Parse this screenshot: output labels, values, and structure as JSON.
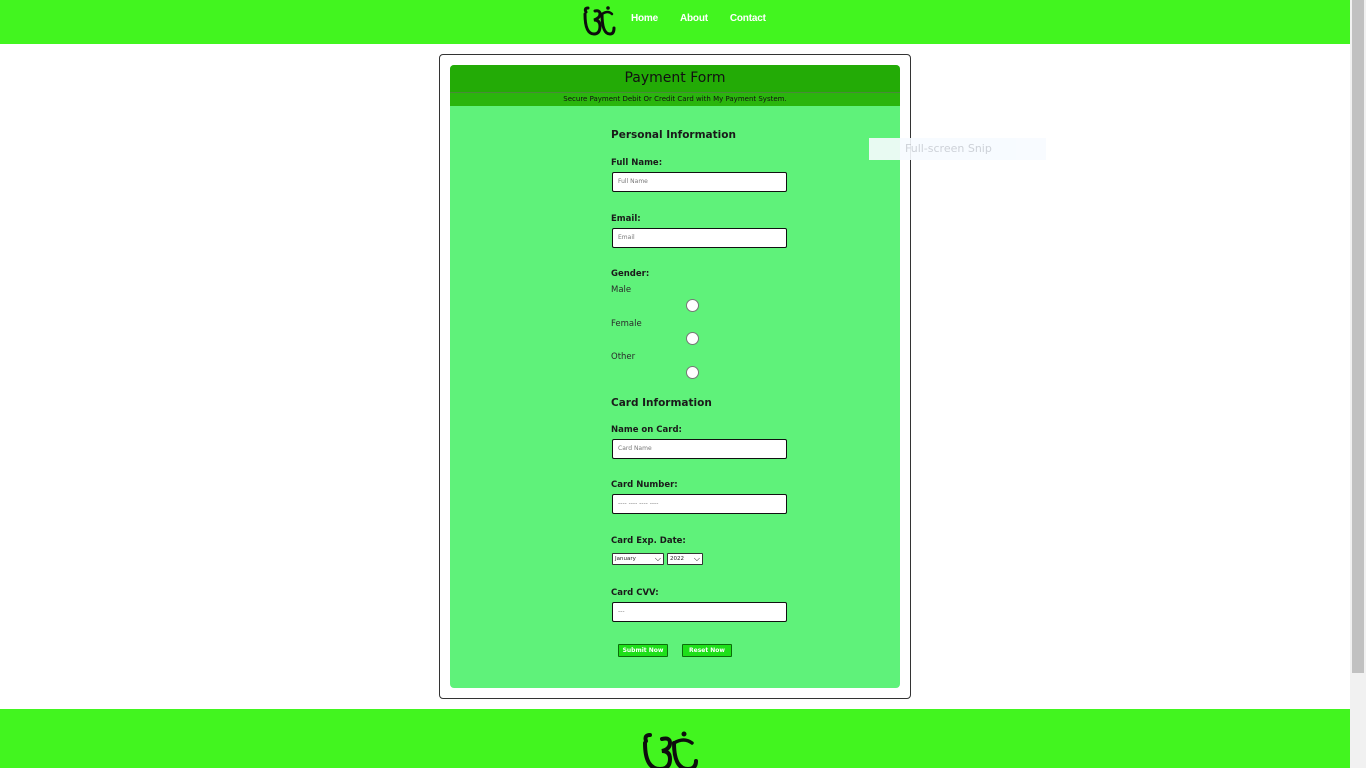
{
  "nav": {
    "links": [
      "Home",
      "About",
      "Contact"
    ]
  },
  "form": {
    "title": "Payment Form",
    "subtitle": "Secure Payment Debit Or Credit Card with My Payment System.",
    "personal_section": "Personal Information",
    "full_name_label": "Full Name:",
    "full_name_placeholder": "Full Name",
    "email_label": "Email:",
    "email_placeholder": "Email",
    "gender_label": "Gender:",
    "gender_options": [
      "Male",
      "Female",
      "Other"
    ],
    "card_section": "Card Information",
    "name_on_card_label": "Name on Card:",
    "name_on_card_placeholder": "Card Name",
    "card_number_label": "Card Number:",
    "card_number_placeholder": "---- ---- ---- ----",
    "exp_label": "Card Exp. Date:",
    "exp_month": "January",
    "exp_year": "2022",
    "cvv_label": "Card CVV:",
    "cvv_placeholder": "---",
    "submit_label": "Submit Now",
    "reset_label": "Reset Now"
  },
  "overlay": {
    "snip_text": "Full-screen Snip"
  },
  "colors": {
    "nav_bg": "#42f51f",
    "form_bg": "#5ff27a",
    "header_bg": "#23ab06",
    "button_bg": "#1ee01a"
  }
}
